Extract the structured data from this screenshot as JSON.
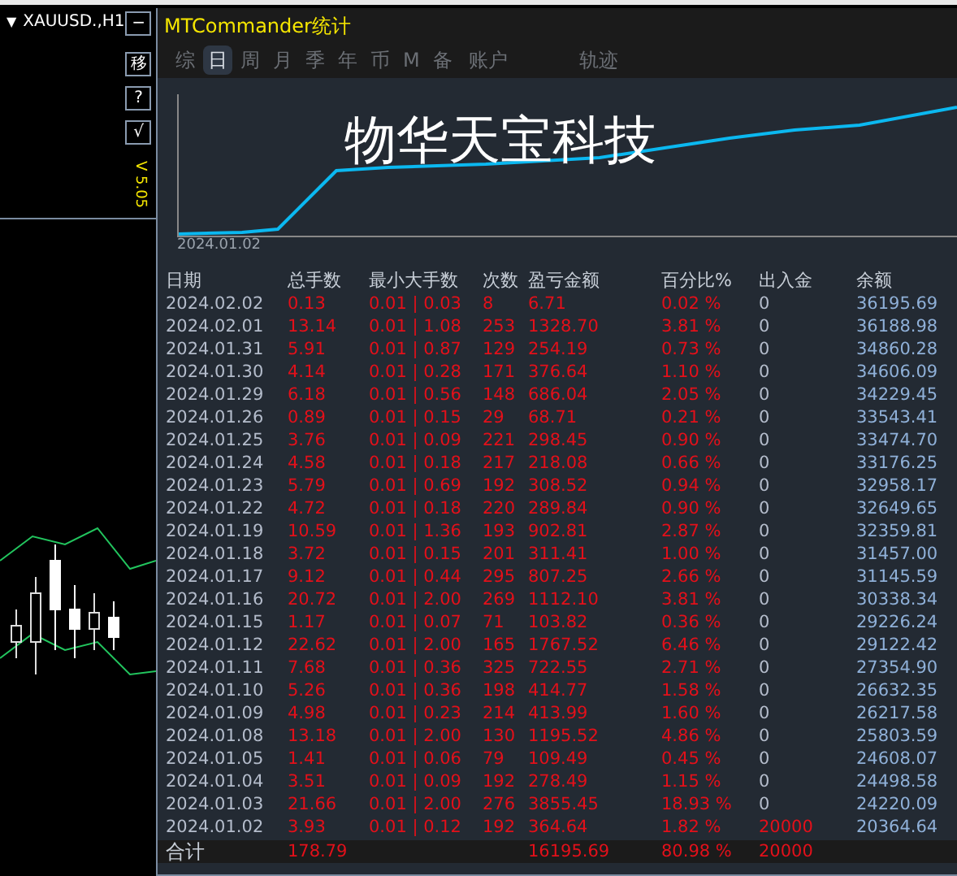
{
  "symbol_panel": {
    "dropdown": "▼",
    "symbol": "XAUUSD.,H1",
    "buttons": [
      "−",
      "移",
      "?",
      "√"
    ],
    "version": "V 5.05"
  },
  "window": {
    "title": "MTCommander统计"
  },
  "tabs": [
    {
      "label": "综",
      "selected": false
    },
    {
      "label": "日",
      "selected": true
    },
    {
      "label": "周",
      "selected": false
    },
    {
      "label": "月",
      "selected": false
    },
    {
      "label": "季",
      "selected": false
    },
    {
      "label": "年",
      "selected": false
    },
    {
      "label": "币",
      "selected": false
    },
    {
      "label": "M",
      "selected": false
    },
    {
      "label": "备",
      "selected": false
    },
    {
      "label": "账户",
      "selected": false
    },
    {
      "label": "轨迹",
      "selected": false
    }
  ],
  "chart": {
    "overlay_text": "物华天宝科技",
    "start_label": "2024.01.02"
  },
  "table": {
    "columns": [
      "日期",
      "总手数",
      "最小大手数",
      "次数",
      "盈亏金额",
      "百分比%",
      "出入金",
      "余额"
    ],
    "rows": [
      [
        "2024.02.02",
        "0.13",
        "0.01 | 0.03",
        "8",
        "6.71",
        "0.02 %",
        "0",
        "36195.69"
      ],
      [
        "2024.02.01",
        "13.14",
        "0.01 | 1.08",
        "253",
        "1328.70",
        "3.81 %",
        "0",
        "36188.98"
      ],
      [
        "2024.01.31",
        "5.91",
        "0.01 | 0.87",
        "129",
        "254.19",
        "0.73 %",
        "0",
        "34860.28"
      ],
      [
        "2024.01.30",
        "4.14",
        "0.01 | 0.28",
        "171",
        "376.64",
        "1.10 %",
        "0",
        "34606.09"
      ],
      [
        "2024.01.29",
        "6.18",
        "0.01 | 0.56",
        "148",
        "686.04",
        "2.05 %",
        "0",
        "34229.45"
      ],
      [
        "2024.01.26",
        "0.89",
        "0.01 | 0.15",
        "29",
        "68.71",
        "0.21 %",
        "0",
        "33543.41"
      ],
      [
        "2024.01.25",
        "3.76",
        "0.01 | 0.09",
        "221",
        "298.45",
        "0.90 %",
        "0",
        "33474.70"
      ],
      [
        "2024.01.24",
        "4.58",
        "0.01 | 0.18",
        "217",
        "218.08",
        "0.66 %",
        "0",
        "33176.25"
      ],
      [
        "2024.01.23",
        "5.79",
        "0.01 | 0.69",
        "192",
        "308.52",
        "0.94 %",
        "0",
        "32958.17"
      ],
      [
        "2024.01.22",
        "4.72",
        "0.01 | 0.18",
        "220",
        "289.84",
        "0.90 %",
        "0",
        "32649.65"
      ],
      [
        "2024.01.19",
        "10.59",
        "0.01 | 1.36",
        "193",
        "902.81",
        "2.87 %",
        "0",
        "32359.81"
      ],
      [
        "2024.01.18",
        "3.72",
        "0.01 | 0.15",
        "201",
        "311.41",
        "1.00 %",
        "0",
        "31457.00"
      ],
      [
        "2024.01.17",
        "9.12",
        "0.01 | 0.44",
        "295",
        "807.25",
        "2.66 %",
        "0",
        "31145.59"
      ],
      [
        "2024.01.16",
        "20.72",
        "0.01 | 2.00",
        "269",
        "1112.10",
        "3.81 %",
        "0",
        "30338.34"
      ],
      [
        "2024.01.15",
        "1.17",
        "0.01 | 0.07",
        "71",
        "103.82",
        "0.36 %",
        "0",
        "29226.24"
      ],
      [
        "2024.01.12",
        "22.62",
        "0.01 | 2.00",
        "165",
        "1767.52",
        "6.46 %",
        "0",
        "29122.42"
      ],
      [
        "2024.01.11",
        "7.68",
        "0.01 | 0.36",
        "325",
        "722.55",
        "2.71 %",
        "0",
        "27354.90"
      ],
      [
        "2024.01.10",
        "5.26",
        "0.01 | 0.36",
        "198",
        "414.77",
        "1.58 %",
        "0",
        "26632.35"
      ],
      [
        "2024.01.09",
        "4.98",
        "0.01 | 0.23",
        "214",
        "413.99",
        "1.60 %",
        "0",
        "26217.58"
      ],
      [
        "2024.01.08",
        "13.18",
        "0.01 | 2.00",
        "130",
        "1195.52",
        "4.86 %",
        "0",
        "25803.59"
      ],
      [
        "2024.01.05",
        "1.41",
        "0.01 | 0.06",
        "79",
        "109.49",
        "0.45 %",
        "0",
        "24608.07"
      ],
      [
        "2024.01.04",
        "3.51",
        "0.01 | 0.09",
        "192",
        "278.49",
        "1.15 %",
        "0",
        "24498.58"
      ],
      [
        "2024.01.03",
        "21.66",
        "0.01 | 2.00",
        "276",
        "3855.45",
        "18.93 %",
        "0",
        "24220.09"
      ],
      [
        "2024.01.02",
        "3.93",
        "0.01 | 0.12",
        "192",
        "364.64",
        "1.82 %",
        "20000",
        "20364.64"
      ]
    ],
    "total": {
      "label": "合计",
      "total_lots": "178.79",
      "profit": "16195.69",
      "percent": "80.98 %",
      "deposit": "20000"
    }
  }
}
